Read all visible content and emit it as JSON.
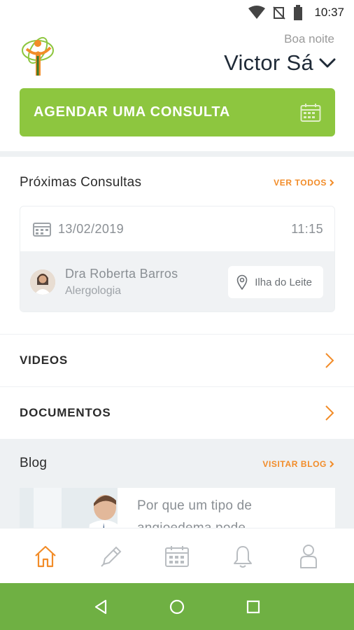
{
  "status_bar": {
    "time": "10:37",
    "icons": [
      "wifi-icon",
      "no-signal-icon",
      "battery-icon"
    ]
  },
  "header": {
    "greeting": "Boa noite",
    "user_name": "Victor Sá",
    "logo": "clinic-logo"
  },
  "cta": {
    "label": "AGENDAR UMA CONSULTA",
    "icon": "calendar-icon"
  },
  "upcoming": {
    "title": "Próximas Consultas",
    "see_all": "VER TODOS",
    "appointment": {
      "date": "13/02/2019",
      "time": "11:15",
      "doctor": "Dra Roberta Barros",
      "specialty": "Alergologia",
      "location": "Ilha do Leite"
    }
  },
  "menu": {
    "videos": "VIDEOS",
    "documents": "DOCUMENTOS"
  },
  "blog": {
    "title": "Blog",
    "visit": "VISITAR BLOG",
    "post_line1": "Por que um tipo de",
    "post_line2": "angioedema pode"
  },
  "bottom_nav": {
    "items": [
      "home-icon",
      "pencil-icon",
      "calendar-icon",
      "bell-icon",
      "profile-icon"
    ],
    "active": "home-icon"
  },
  "colors": {
    "accent_green": "#8dc63f",
    "accent_orange": "#f28c28",
    "nav_bar_green": "#6fb043"
  }
}
